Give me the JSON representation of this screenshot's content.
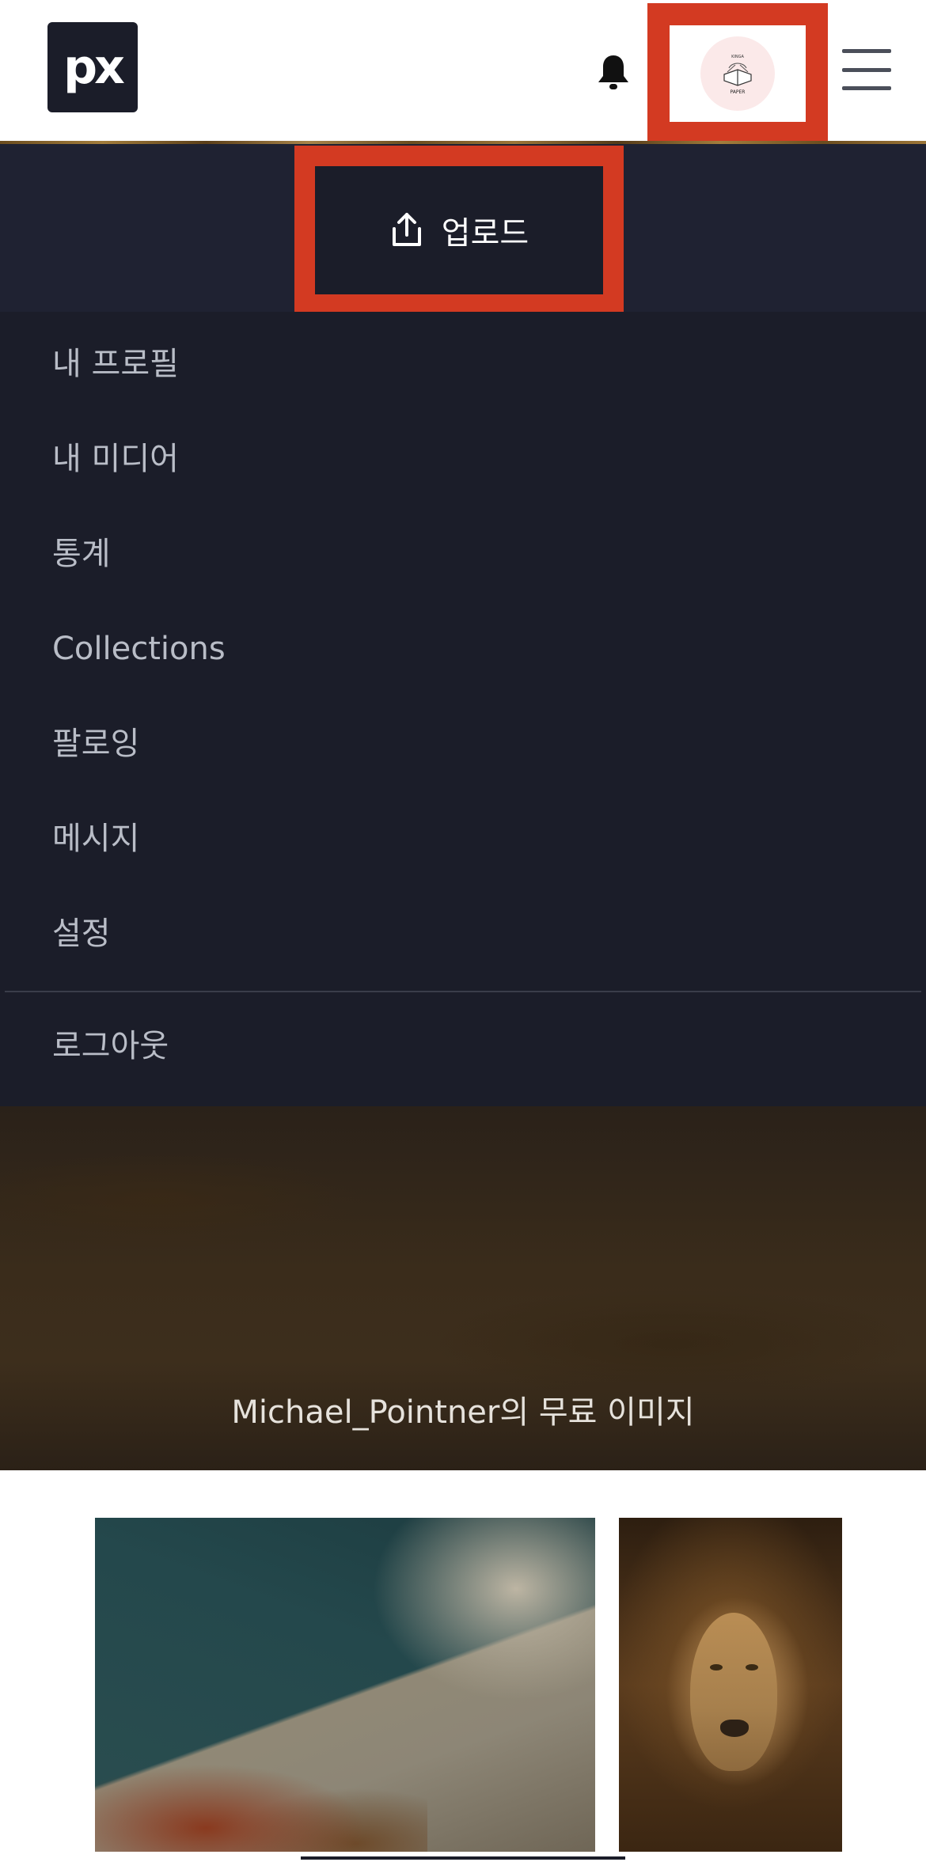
{
  "header": {
    "logo_text": "px",
    "icons": {
      "notifications": "bell-icon",
      "menu": "hamburger-icon",
      "upload": "upload-icon"
    },
    "avatar": {
      "lines": [
        "KINGA",
        "PAPER"
      ]
    }
  },
  "upload": {
    "label": "업로드"
  },
  "menu": {
    "items": [
      {
        "label": "내 프로필"
      },
      {
        "label": "내 미디어"
      },
      {
        "label": "통계"
      },
      {
        "label": "Collections"
      },
      {
        "label": "팔로잉"
      },
      {
        "label": "메시지"
      },
      {
        "label": "설정"
      }
    ],
    "logout": "로그아웃"
  },
  "hero": {
    "caption": "Michael_Pointner의 무료 이미지"
  },
  "colors": {
    "header_bg": "#ffffff",
    "menu_bg": "#1b1d29",
    "highlight": "#d33a22",
    "menu_text": "#b9bdc7"
  }
}
